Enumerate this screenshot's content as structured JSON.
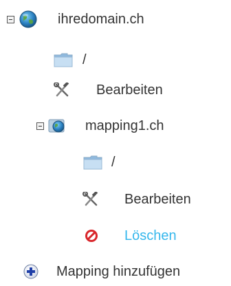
{
  "tree": {
    "domain": {
      "label": "ihredomain.ch",
      "icon": "globe-icon",
      "expanded": true,
      "children": {
        "root_folder": {
          "label": "/",
          "icon": "folder-icon"
        },
        "edit": {
          "label": "Bearbeiten",
          "icon": "tools-icon"
        },
        "mapping": {
          "label": "mapping1.ch",
          "icon": "mapping-globe-icon",
          "expanded": true,
          "children": {
            "folder": {
              "label": "/",
              "icon": "folder-icon"
            },
            "edit": {
              "label": "Bearbeiten",
              "icon": "tools-icon"
            },
            "delete": {
              "label": "Löschen",
              "icon": "delete-icon",
              "color": "#35b7ec"
            }
          }
        }
      }
    },
    "add_mapping": {
      "label": "Mapping hinzufügen",
      "icon": "add-icon"
    }
  },
  "colors": {
    "text": "#333333",
    "link": "#35b7ec",
    "delete_icon": "#d9262b",
    "add_icon": "#1f3fa8",
    "folder": "#a9cbe8"
  }
}
